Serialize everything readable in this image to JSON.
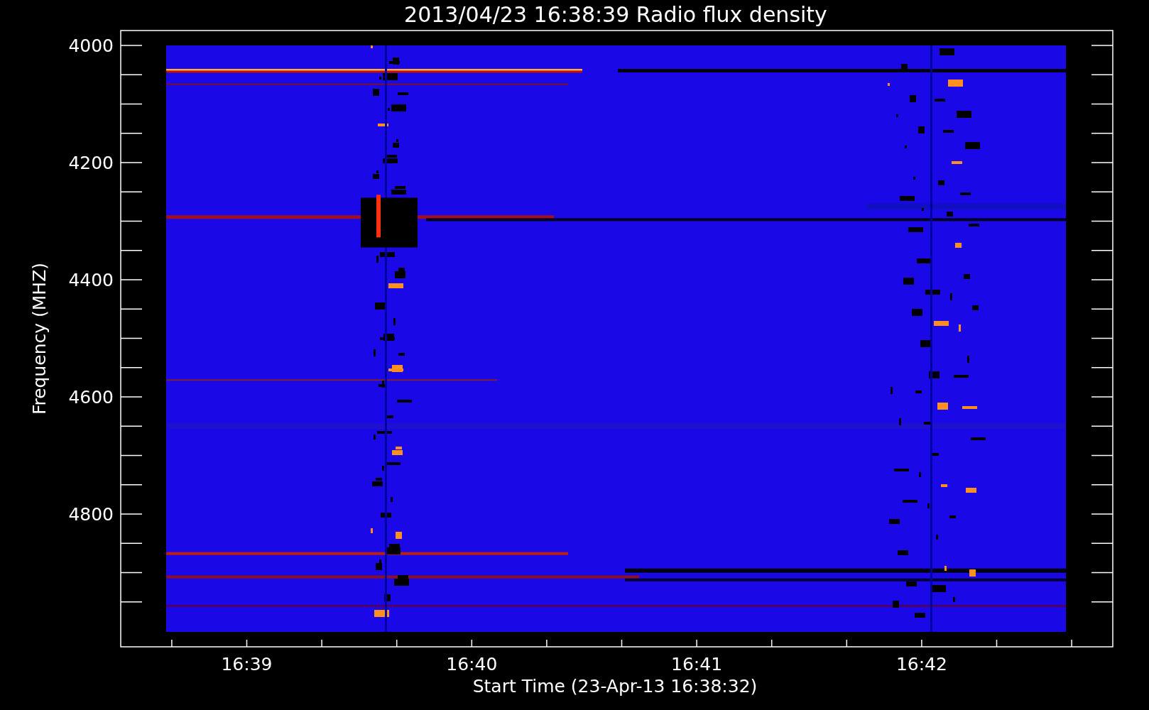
{
  "title": "2013/04/23 16:38:39 Radio flux density",
  "y_axis": {
    "label": "Frequency (MHZ)",
    "ticks": [
      "4000",
      "4200",
      "4400",
      "4600",
      "4800"
    ]
  },
  "x_axis": {
    "label": "Start Time (23-Apr-13 16:38:32)",
    "ticks": [
      "16:39",
      "16:40",
      "16:41",
      "16:42"
    ]
  }
}
